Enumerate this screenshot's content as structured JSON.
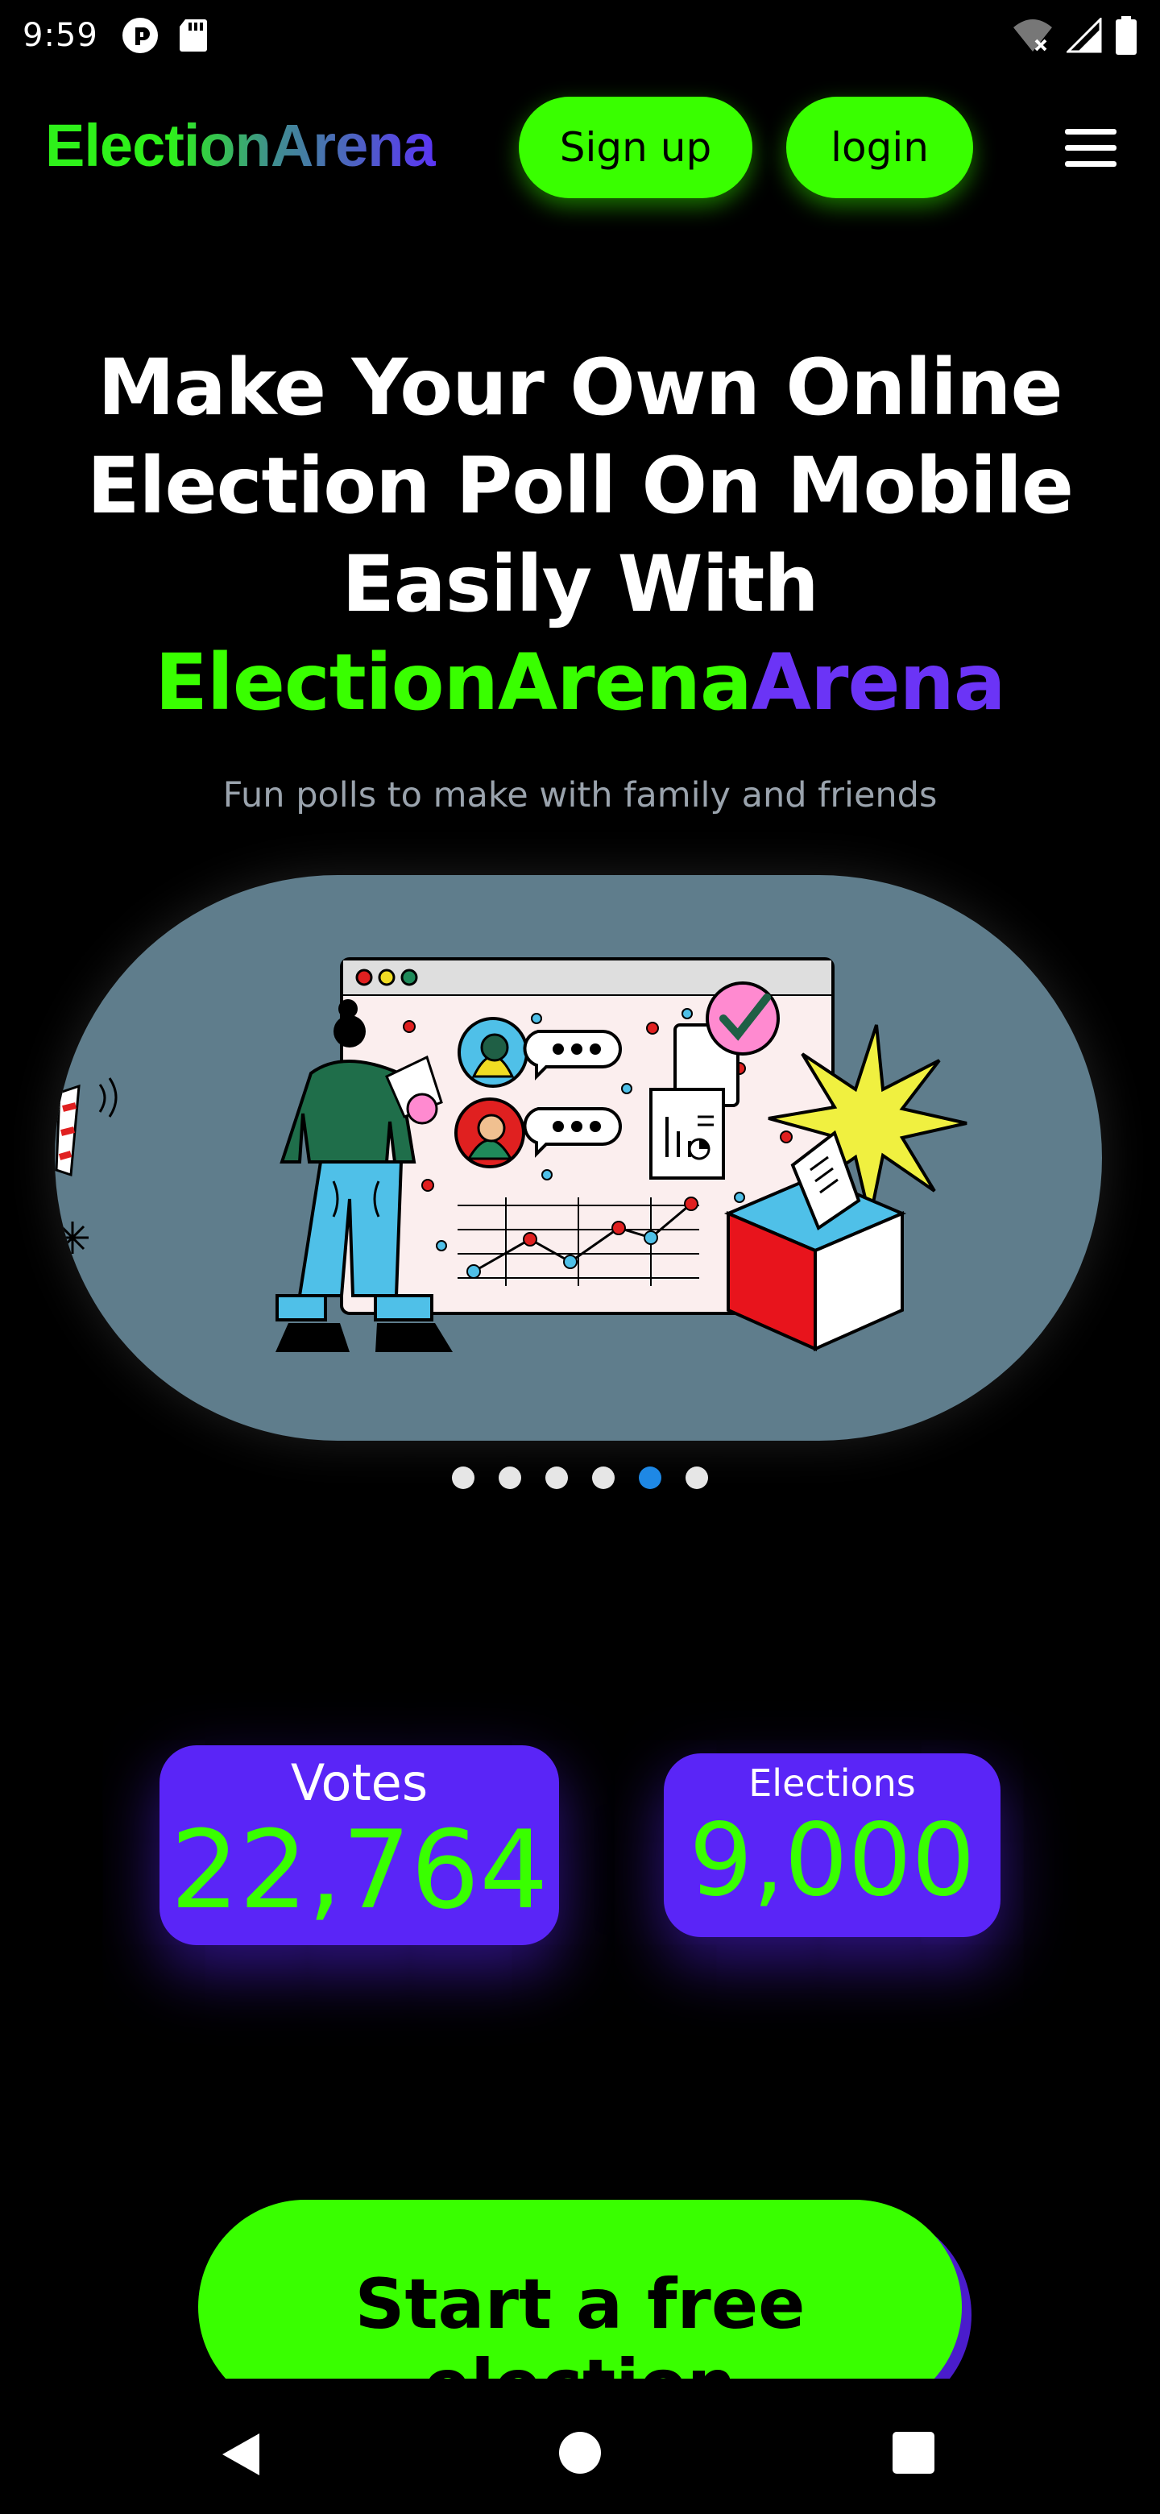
{
  "status_bar": {
    "time": "9:59"
  },
  "header": {
    "logo": "ElectionArena",
    "signup_label": "Sign up",
    "login_label": "login"
  },
  "hero": {
    "title_line1": "Make Your Own Online",
    "title_line2": "Election Poll On Mobile",
    "title_line3": "Easily With",
    "title_brand_green": "ElectionArena",
    "title_brand_purple": "Arena",
    "subtitle": "Fun polls to make with family and friends"
  },
  "carousel": {
    "slide_count": 6,
    "active_index": 4
  },
  "stats": {
    "votes_label": "Votes",
    "votes_value": "22,764",
    "elections_label": "Elections",
    "elections_value": "9,000"
  },
  "cta": {
    "label": "Start a free election"
  },
  "colors": {
    "accent_green": "#39ff00",
    "accent_purple": "#5a25f7",
    "carousel_bg": "#5f7d8c",
    "dot_active": "#1e88e5"
  },
  "icons": [
    "pocket-casts-icon",
    "sd-card-icon",
    "wifi-off-icon",
    "signal-icon",
    "battery-icon",
    "menu-icon",
    "back-icon",
    "home-icon",
    "recents-icon"
  ]
}
